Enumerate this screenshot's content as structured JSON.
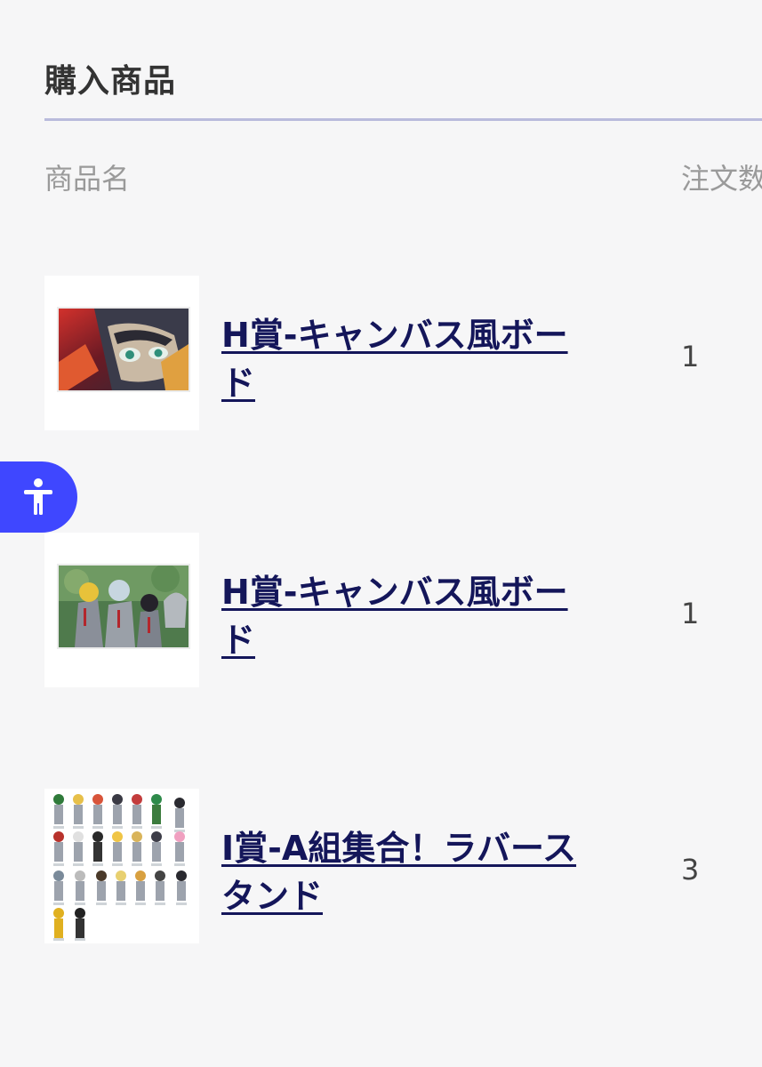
{
  "section": {
    "title": "購入商品"
  },
  "table": {
    "headers": {
      "name": "商品名",
      "quantity": "注文数"
    },
    "rows": [
      {
        "name": "H賞-キャンバス風ボード",
        "quantity": "1",
        "thumbnail": "anime-canvas-board-closeup"
      },
      {
        "name": "H賞-キャンバス風ボード",
        "quantity": "1",
        "thumbnail": "anime-canvas-board-group"
      },
      {
        "name": "I賞-A組集合！ラバースタンド",
        "quantity": "3",
        "thumbnail": "rubber-stand-lineup"
      }
    ]
  },
  "accessibility": {
    "icon": "accessibility-person-icon",
    "color": "#3f47ff"
  },
  "colors": {
    "background": "#f6f6f7",
    "link": "#14165a",
    "rule": "#b9bbdc"
  }
}
